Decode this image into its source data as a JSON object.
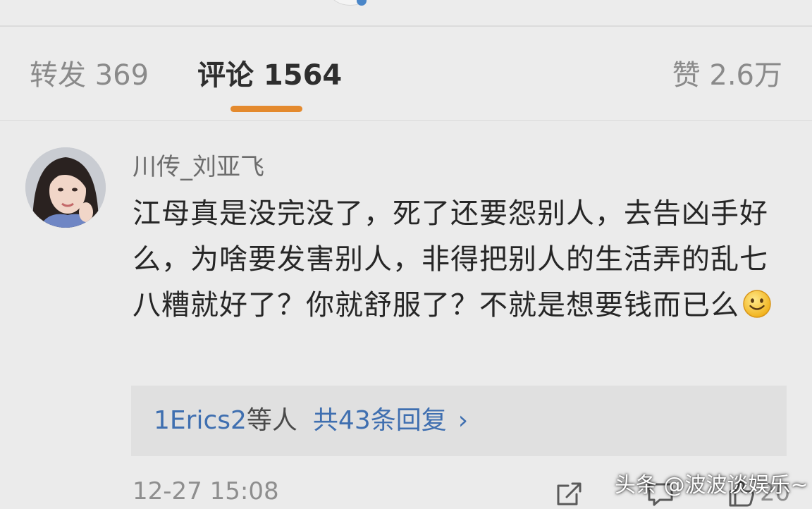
{
  "tabs": {
    "repost": "转发 369",
    "comments": "评论 1564",
    "likes": "赞 2.6万",
    "active": "comments"
  },
  "comment": {
    "username": "川传_刘亚飞",
    "text": "江母真是没完没了，死了还要怨别人，去告凶手好么，为啥要发害别人，非得把别人的生活弄的乱七八糟就好了？你就舒服了？不就是想要钱而已么",
    "emoji": "smile-emoji",
    "replies": {
      "users": "1Erics2",
      "users_suffix": "等人",
      "count": "共43条回复",
      "chevron": "›"
    },
    "timestamp": "12-27 15:08",
    "like_count": "20"
  },
  "watermark": "头条 @波波谈娱乐~",
  "colors": {
    "background": "#ebebeb",
    "accent": "#e48a2e",
    "link": "#3f6fb0",
    "text": "#262626",
    "muted": "#8e8e8e"
  },
  "icons": [
    "share-icon",
    "comment-icon",
    "like-icon"
  ]
}
